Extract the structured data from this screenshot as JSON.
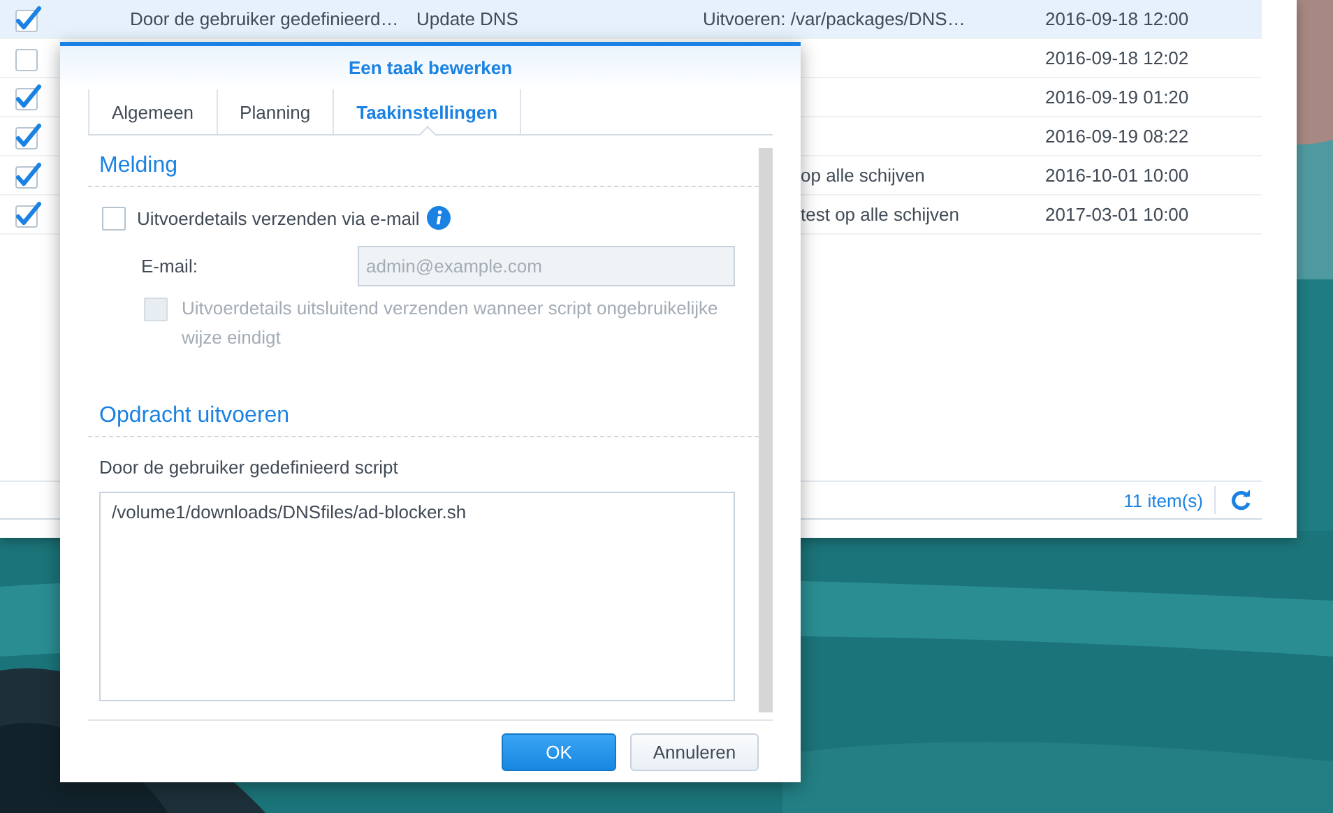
{
  "table": {
    "rows": [
      {
        "selected": true,
        "checked": true,
        "column_1": "Door de gebruiker gedefinieerd…",
        "column_2": "Update DNS",
        "column_3": "Uitvoeren: /var/packages/DNS…",
        "column_4": "2016-09-18 12:00"
      },
      {
        "selected": false,
        "checked": false,
        "column_4": "2016-09-18 12:02"
      },
      {
        "selected": false,
        "checked": true,
        "column_4": "2016-09-19 01:20"
      },
      {
        "selected": false,
        "checked": true,
        "column_4": "2016-09-19 08:22"
      },
      {
        "selected": false,
        "checked": true,
        "column_3": "op alle schijven",
        "column_4": "2016-10-01 10:00"
      },
      {
        "selected": false,
        "checked": true,
        "column_3": "test op alle schijven",
        "column_4": "2017-03-01 10:00"
      }
    ]
  },
  "status_bar": {
    "count": "11 item(s)"
  },
  "dialog": {
    "title": "Een taak bewerken",
    "tabs": [
      {
        "label": "Algemeen",
        "selected": false
      },
      {
        "label": "Planning",
        "selected": false
      },
      {
        "label": "Taakinstellingen",
        "selected": true
      }
    ],
    "notification": {
      "heading": "Melding",
      "send_email": {
        "label": "Uitvoerdetails verzenden via e-mail",
        "checked": false
      },
      "email": {
        "label": "E-mail:",
        "placeholder": "admin@example.com",
        "disabled": true
      },
      "only_on_error": {
        "label": "Uitvoerdetails uitsluitend verzenden wanneer script ongebruikelijke wijze eindigt",
        "checked": false,
        "disabled": true
      }
    },
    "run_command": {
      "heading": "Opdracht uitvoeren",
      "label": "Door de gebruiker gedefinieerd script",
      "value": "/volume1/downloads/DNSfiles/ad-blocker.sh"
    },
    "buttons": [
      {
        "label": "OK",
        "kind": "primary"
      },
      {
        "label": "Annuleren",
        "kind": "secondary"
      }
    ]
  }
}
